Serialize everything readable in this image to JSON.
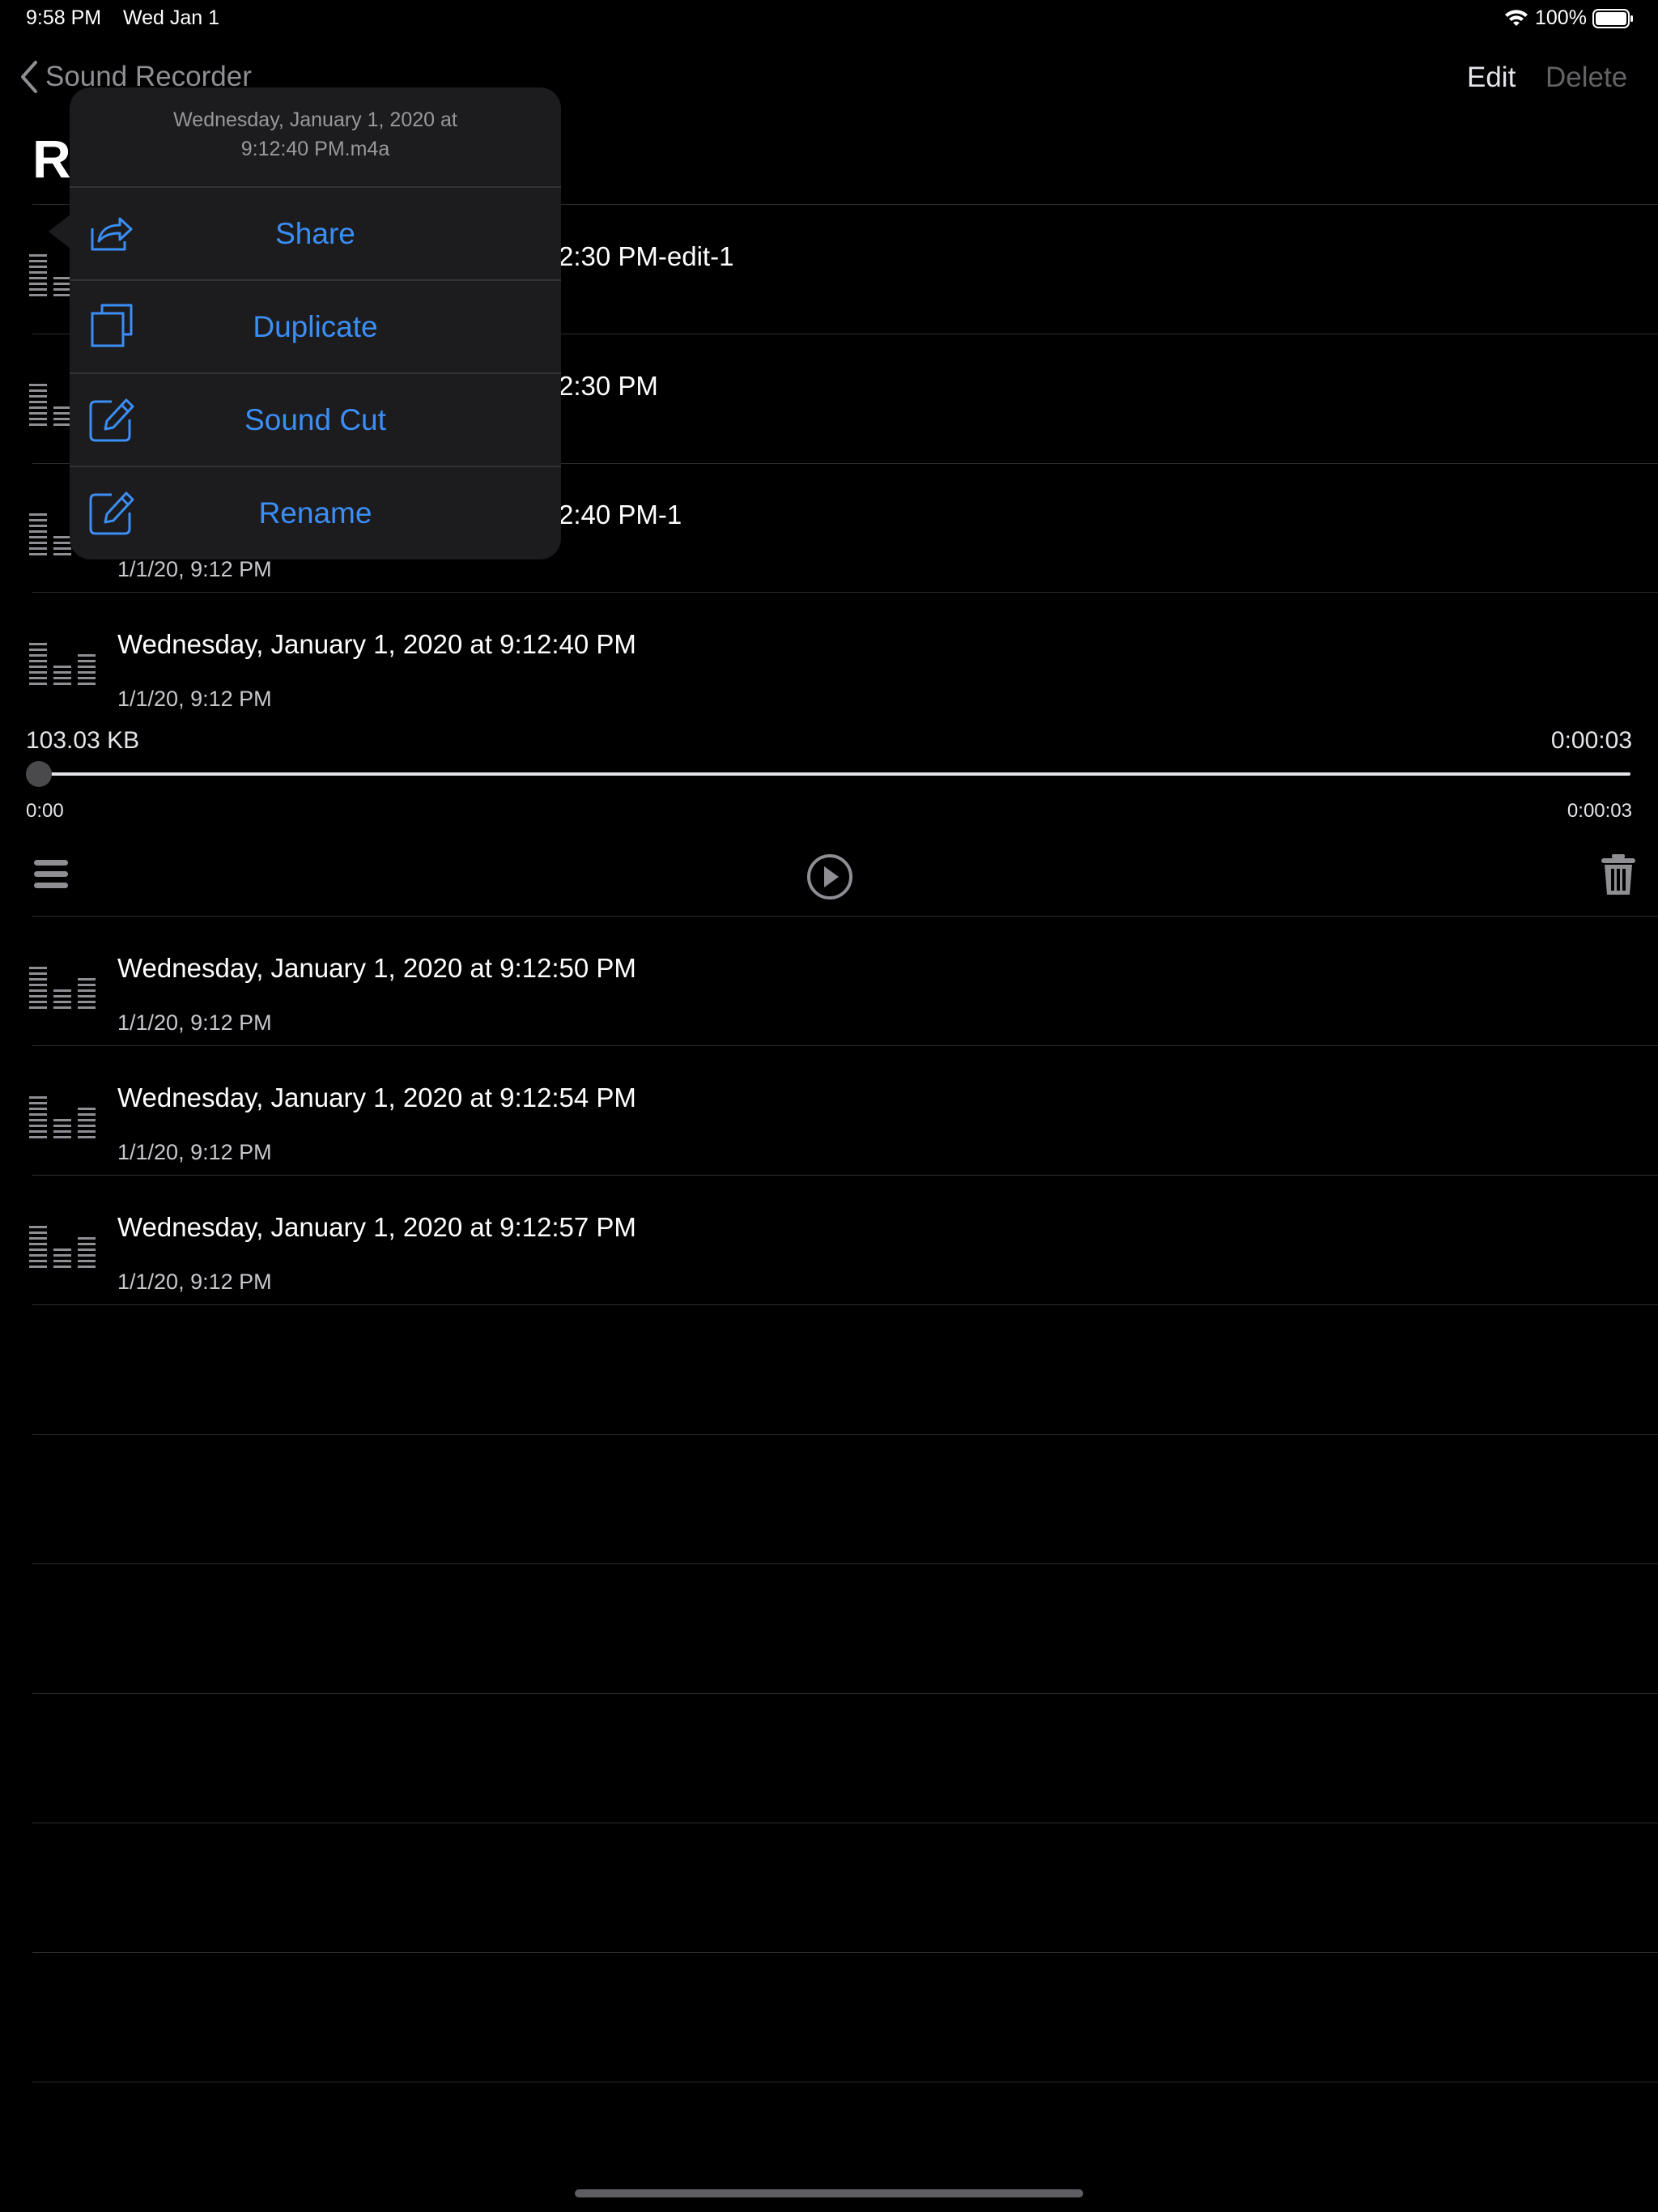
{
  "status_bar": {
    "time": "9:58 PM",
    "date": "Wed Jan 1",
    "battery": "100%"
  },
  "nav": {
    "back_label": "Sound Recorder",
    "edit_label": "Edit",
    "delete_label": "Delete",
    "title_partial": "Re"
  },
  "recordings": [
    {
      "title_partial": "2:30 PM-edit-1"
    },
    {
      "title_partial": "2:30 PM"
    },
    {
      "title_partial": "2:40 PM-1",
      "subtitle": "1/1/20, 9:12 PM"
    },
    {
      "title": "Wednesday, January 1, 2020 at 9:12:40 PM",
      "subtitle": "1/1/20, 9:12 PM"
    },
    {
      "title": "Wednesday, January 1, 2020 at 9:12:50 PM",
      "subtitle": "1/1/20, 9:12 PM"
    },
    {
      "title": "Wednesday, January 1, 2020 at 9:12:54 PM",
      "subtitle": "1/1/20, 9:12 PM"
    },
    {
      "title": "Wednesday, January 1, 2020 at 9:12:57 PM",
      "subtitle": "1/1/20, 9:12 PM"
    }
  ],
  "player": {
    "file_size": "103.03 KB",
    "duration": "0:00:03",
    "elapsed": "0:00",
    "end_time": "0:00:03",
    "progress": 0
  },
  "popover": {
    "header_line1": "Wednesday, January 1, 2020 at",
    "header_line2": "9:12:40 PM.m4a",
    "items": [
      {
        "label": "Share",
        "icon": "share-icon"
      },
      {
        "label": "Duplicate",
        "icon": "duplicate-icon"
      },
      {
        "label": "Sound Cut",
        "icon": "edit-icon"
      },
      {
        "label": "Rename",
        "icon": "edit-icon"
      }
    ]
  },
  "colors": {
    "accent": "#3b8ef5",
    "background": "#000000",
    "popover_bg": "#1c1c1e"
  }
}
